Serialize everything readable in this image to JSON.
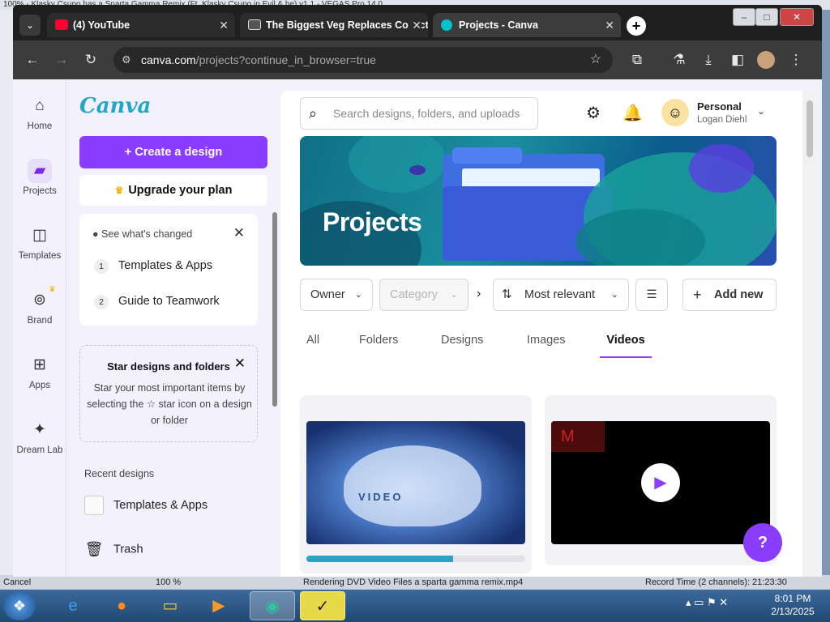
{
  "background_app": {
    "title": "100% - Klasky Csupo has a Sparta Gamma Remix (Ft. Klasky Csupo in Evil & he) v1.1 - VEGAS Pro 14.0",
    "status_left": "Cancel",
    "status_zoom": "100 %",
    "status_render": "Rendering DVD Video Files a sparta gamma remix.mp4",
    "status_record": "Record Time (2 channels): 21:23:30"
  },
  "browser": {
    "tabs": [
      {
        "title": "(4) YouTube",
        "favicon_color": "#ff0033"
      },
      {
        "title": "The Biggest Veg Replaces Collection",
        "favicon_color": "#dddddd"
      },
      {
        "title": "Projects - Canva",
        "favicon_color": "#00c4cc"
      }
    ],
    "url_host": "canva.com",
    "url_rest": "/projects?continue_in_browser=true"
  },
  "rail": {
    "items": [
      {
        "label": "Home",
        "icon": "home-icon"
      },
      {
        "label": "Projects",
        "icon": "folder-icon"
      },
      {
        "label": "Templates",
        "icon": "templates-icon"
      },
      {
        "label": "Brand",
        "icon": "brand-icon"
      },
      {
        "label": "Apps",
        "icon": "apps-icon"
      },
      {
        "label": "Dream Lab",
        "icon": "dream-lab-icon"
      }
    ]
  },
  "panel": {
    "logo": "Canva",
    "create_label": "Create a design",
    "upgrade_label": "Upgrade your plan",
    "changes_heading": "See what's changed",
    "changes": [
      {
        "num": "1",
        "label": "Templates & Apps"
      },
      {
        "num": "2",
        "label": "Guide to Teamwork"
      }
    ],
    "star_title": "Star designs and folders",
    "star_body": "Star your most important items by selecting the ☆ star icon on a design or folder",
    "recent_heading": "Recent designs",
    "recent_item": "Templates & Apps",
    "trash_label": "Trash"
  },
  "main": {
    "search_placeholder": "Search designs, folders, and uploads",
    "account_name": "Personal",
    "account_user": "Logan Diehl",
    "banner_title": "Projects",
    "filters": {
      "owner": "Owner",
      "category": "Category",
      "sort": "Most relevant",
      "add_new": "Add new"
    },
    "tabs": [
      "All",
      "Folders",
      "Designs",
      "Images",
      "Videos"
    ],
    "active_tab": "Videos",
    "cards": [
      {
        "thumb_text": "VIDEO",
        "progress": 0.67
      },
      {
        "thumb_text": "M"
      }
    ],
    "help": "?"
  },
  "taskbar": {
    "time": "8:01 PM",
    "date": "2/13/2025"
  },
  "colors": {
    "accent": "#8b3dff",
    "brand_teal": "#22a7c9"
  }
}
